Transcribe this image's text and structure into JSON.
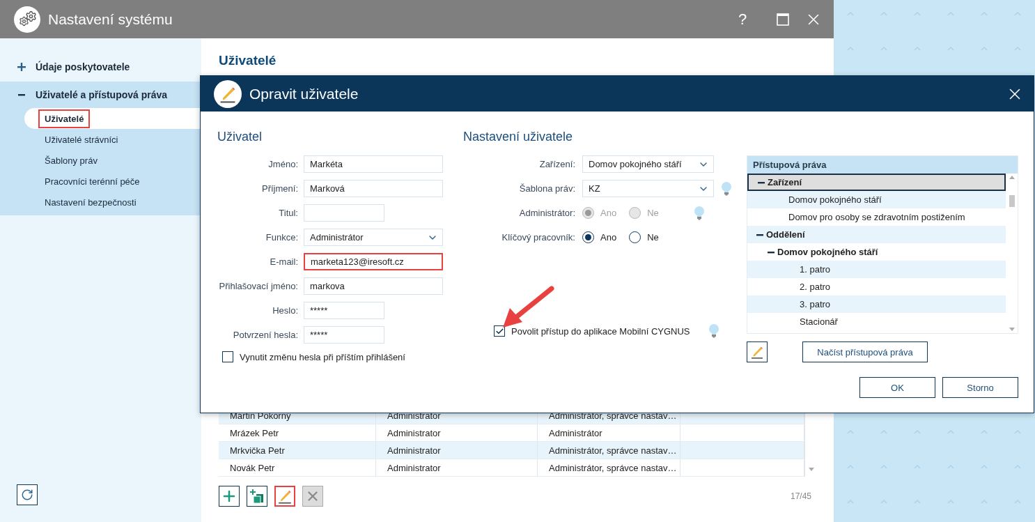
{
  "window": {
    "title": "Nastavení systému",
    "help": "?"
  },
  "sidebar": {
    "sections": [
      {
        "label": "Údaje poskytovatele",
        "expanded": false
      },
      {
        "label": "Uživatelé a přístupová práva",
        "expanded": true,
        "items": [
          {
            "label": "Uživatelé",
            "selected": true,
            "highlighted": true
          },
          {
            "label": "Uživatelé strávníci",
            "selected": false,
            "highlighted": false
          },
          {
            "label": "Šablony práv",
            "selected": false,
            "highlighted": false
          },
          {
            "label": "Pracovníci terénní péče",
            "selected": false,
            "highlighted": false
          },
          {
            "label": "Nastavení bezpečnosti",
            "selected": false,
            "highlighted": false
          }
        ]
      }
    ]
  },
  "content": {
    "heading": "Uživatelé",
    "table": {
      "rows": [
        {
          "cells": [
            "Martin Pokorný",
            "Administrator",
            "Administrátor, správce nastav…"
          ]
        },
        {
          "cells": [
            "Mrázek Petr",
            "Administrator",
            "Administrátor"
          ]
        },
        {
          "cells": [
            "Mrkvička Petr",
            "Administrator",
            "Administrátor, správce nastav…"
          ]
        },
        {
          "cells": [
            "Novák Petr",
            "Administrator",
            "Administrátor, správce nastav…"
          ]
        }
      ]
    },
    "toolbar": [
      {
        "kind": "add",
        "disabled": false,
        "highlighted": false
      },
      {
        "kind": "copy",
        "disabled": false,
        "highlighted": false
      },
      {
        "kind": "edit",
        "disabled": false,
        "highlighted": true
      },
      {
        "kind": "delete",
        "disabled": true,
        "highlighted": false
      }
    ],
    "counter": "17/45"
  },
  "dialog": {
    "title": "Opravit uživatele",
    "user": {
      "heading": "Uživatel",
      "fields": [
        {
          "label": "Jméno:",
          "value": "Markéta",
          "kind": "input",
          "highlighted": false
        },
        {
          "label": "Příjmení:",
          "value": "Marková",
          "kind": "input",
          "highlighted": false
        },
        {
          "label": "Titul:",
          "kind": "short",
          "highlighted": false
        },
        {
          "label": "Funkce:",
          "value": "Administrátor",
          "kind": "select",
          "highlighted": false
        },
        {
          "label": "E-mail:",
          "value": "marketa123@iresoft.cz",
          "kind": "input",
          "highlighted": true
        },
        {
          "label": "Přihlašovací jméno:",
          "value": "markova",
          "kind": "input",
          "highlighted": false
        },
        {
          "label": "Heslo:",
          "value": "*****",
          "kind": "short",
          "highlighted": false
        },
        {
          "label": "Potvrzení hesla:",
          "value": "*****",
          "kind": "short",
          "highlighted": false
        }
      ],
      "force_change": {
        "label": "Vynutit změnu hesla při příštím přihlášení",
        "checked": false
      }
    },
    "settings": {
      "heading": "Nastavení uživatele",
      "rows": [
        {
          "kind": "select",
          "label": "Zařízení:",
          "value": "Domov pokojného stáří",
          "hint": false
        },
        {
          "kind": "select",
          "label": "Šablona práv:",
          "value": "KZ",
          "hint": true
        },
        {
          "kind": "radio",
          "label": "Administrátor:",
          "disabled": true,
          "hint": true,
          "options": [
            {
              "label": "Ano",
              "selected": true
            },
            {
              "label": "Ne",
              "selected": false
            }
          ]
        },
        {
          "kind": "radio",
          "label": "Klíčový pracovník:",
          "disabled": false,
          "hint": false,
          "options": [
            {
              "label": "Ano",
              "selected": true
            },
            {
              "label": "Ne",
              "selected": false
            }
          ]
        }
      ],
      "mobile": {
        "label": "Povolit přístup do aplikace Mobilní CYGNUS",
        "checked": true,
        "hint": true
      }
    },
    "rights": {
      "heading": "Přístupová práva",
      "tree": [
        {
          "label": "Zařízení",
          "expanded": true,
          "selected": true,
          "children": [
            {
              "label": "Domov pokojného stáří",
              "selected": false
            },
            {
              "label": "Domov pro osoby se zdravotním postižením",
              "selected": false
            }
          ]
        },
        {
          "label": "Oddělení",
          "expanded": true,
          "selected": false,
          "children": [
            {
              "label": "Domov pokojného stáří",
              "expanded": true,
              "selected": false,
              "children": [
                {
                  "label": "1. patro",
                  "selected": false
                },
                {
                  "label": "2. patro",
                  "selected": false
                },
                {
                  "label": "3. patro",
                  "selected": false
                },
                {
                  "label": "Stacionář",
                  "selected": false
                }
              ]
            }
          ]
        }
      ],
      "load_button": "Načíst přístupová práva"
    },
    "buttons": [
      "OK",
      "Storno"
    ]
  }
}
